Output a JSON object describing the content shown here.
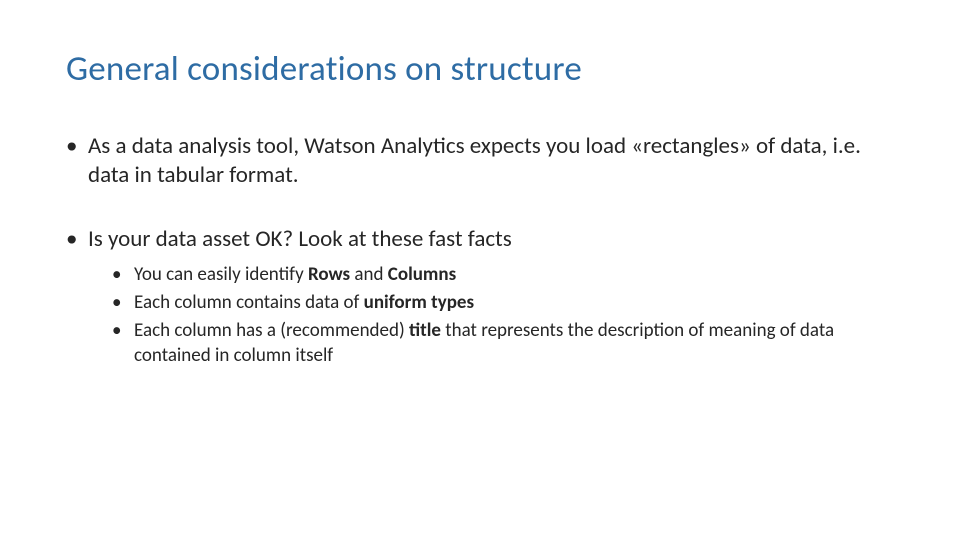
{
  "title": "General considerations on structure",
  "bullet_char": "•",
  "items": [
    {
      "text": "As a data analysis tool, Watson Analytics expects you load «rectangles» of data, i.e. data in tabular format."
    },
    {
      "text": "Is your data asset OK? Look at these fast facts",
      "children": [
        {
          "html": "You can easily identify <b>Rows</b> and <b>Columns</b>"
        },
        {
          "html": "Each column contains data of <b>uniform types</b>"
        },
        {
          "html": "Each column has a (recommended) <b>title</b> that represents the description of meaning of data contained in column itself"
        }
      ]
    }
  ]
}
